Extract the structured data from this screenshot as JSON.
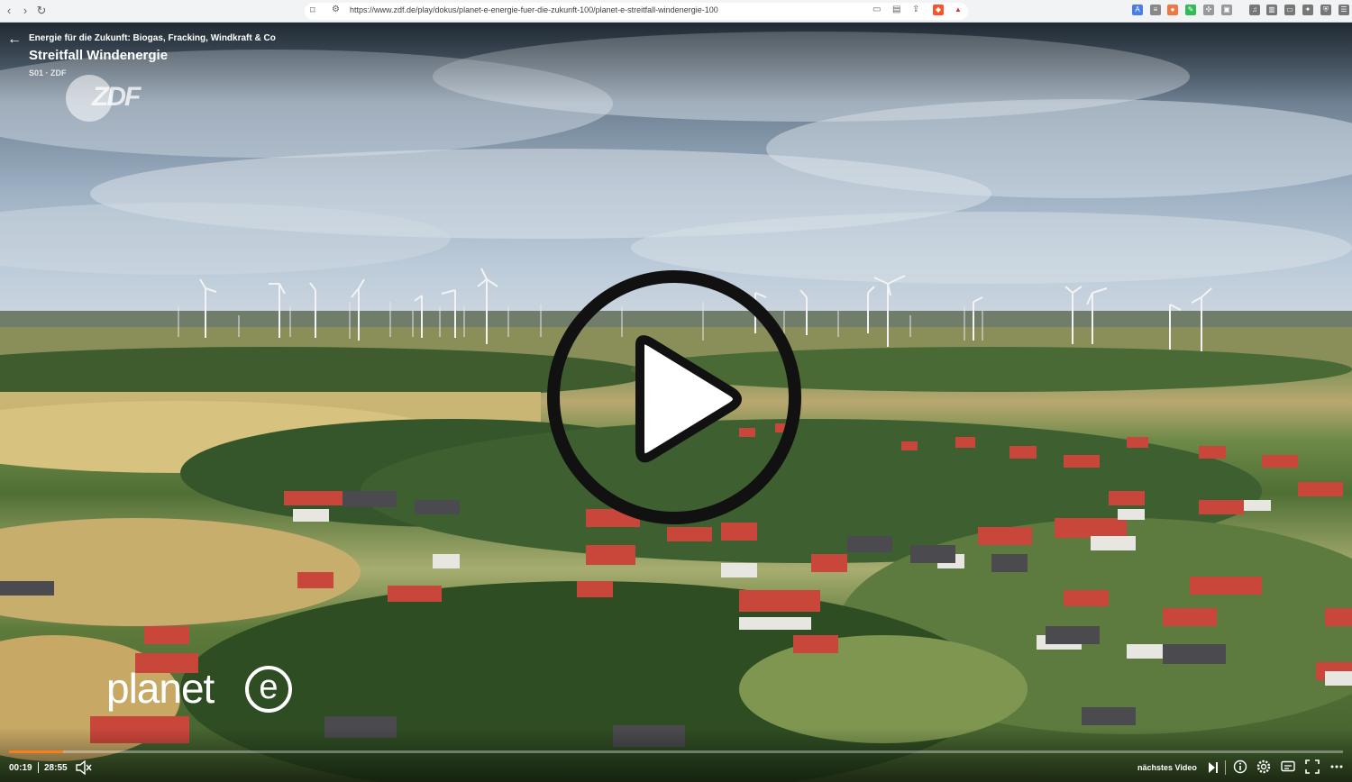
{
  "browser": {
    "url": "https://www.zdf.de/play/dokus/planet-e-energie-fuer-die-zukunft-100/planet-e-streitfall-windenergie-100"
  },
  "player": {
    "series_title": "Energie für die Zukunft: Biogas, Fracking, Windkraft & Co",
    "episode_title": "Streitfall Windenergie",
    "episode_meta": "S01 · ZDF",
    "time_current": "00:19",
    "time_total": "28:55",
    "progress": 0.011,
    "next_video_label": "nächstes Video",
    "channel_logo": "ZDF",
    "show_logo": "planet",
    "show_logo_e": "e",
    "accent_color": "#fa7d19"
  }
}
